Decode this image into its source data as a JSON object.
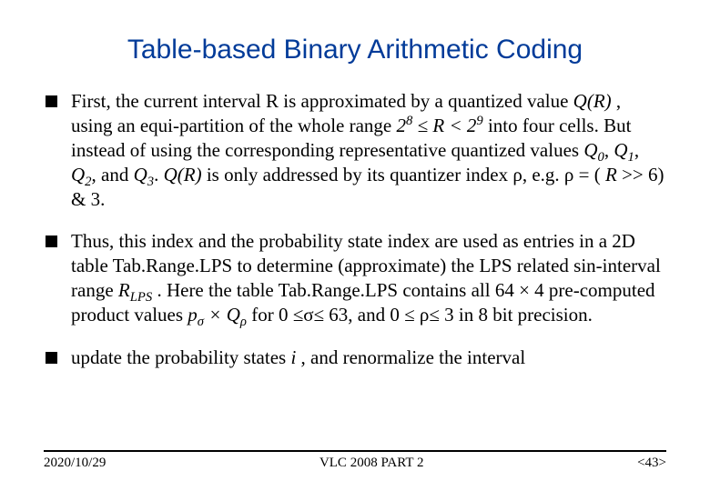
{
  "title": "Table-based Binary Arithmetic Coding",
  "bullets": {
    "b1": {
      "t0": "First, the current interval R is approximated by a quantized value ",
      "qr": "Q(R)",
      "t1": ", using an equi-partition of the whole range ",
      "r28": "2",
      "e8": "8",
      "leq": "≤ ",
      "r": "R ",
      "lt": "< ",
      "r29": "2",
      "e9": "9",
      "t2": " into four cells. But instead of using the corresponding representative quantized values ",
      "q0": "Q",
      "s0": "0",
      "c0": ", ",
      "q1": "Q",
      "s1": "1",
      "c1": ", ",
      "q2": "Q",
      "s2": "2",
      "c2": ", and ",
      "q3": "Q",
      "s3": "3",
      "dot": ". ",
      "qr2": "Q(R)",
      "t3": " is only addressed by its quantizer index ρ, e.g. ρ = (",
      "rr": "R",
      "t4": ">> 6) & 3."
    },
    "b2": {
      "t0": "Thus, this index and the probability state index are used as entries in a 2D table  Tab.Range.LPS to determine (approximate) the LPS related sin-interval range ",
      "rl": "R",
      "rls": "LPS",
      "t1": ". Here the table Tab.Range.LPS contains all 64 × 4 pre-computed product values ",
      "ps": "p",
      "pss": "σ",
      "mul": " × ",
      "qr": "Q",
      "qrs": "ρ",
      "t2": " for 0 ≤σ≤ 63, and 0 ≤ ρ≤ 3 in 8 bit precision."
    },
    "b3": {
      "t0": "update the probability states ",
      "i": "i",
      "t1": ", and renormalize the interval"
    }
  },
  "footer": {
    "left": "2020/10/29",
    "center": "VLC 2008 PART 2",
    "right": "<43>"
  }
}
